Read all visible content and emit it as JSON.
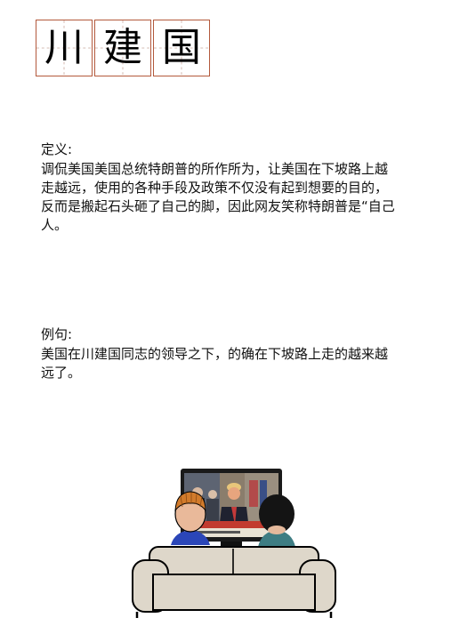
{
  "title": {
    "chars": [
      "川",
      "建",
      "国"
    ]
  },
  "definition": {
    "label": "定义:",
    "lines": [
      "调侃美国美国总统特朗普的所作所为，让美国在下坡路上越",
      "走越远，使用的各种手段及政策不仅没有起到想要的目的，",
      "反而是搬起石头砸了自己的脚，因此网友笑称特朗普是“自己",
      "人。"
    ]
  },
  "example": {
    "label": "例句:",
    "lines": [
      "美国在川建国同志的领导之下，的确在下坡路上走的越来越",
      "远了。"
    ]
  },
  "colors": {
    "grid_border": "#b3593c",
    "grid_dash": "#c9a79b"
  }
}
